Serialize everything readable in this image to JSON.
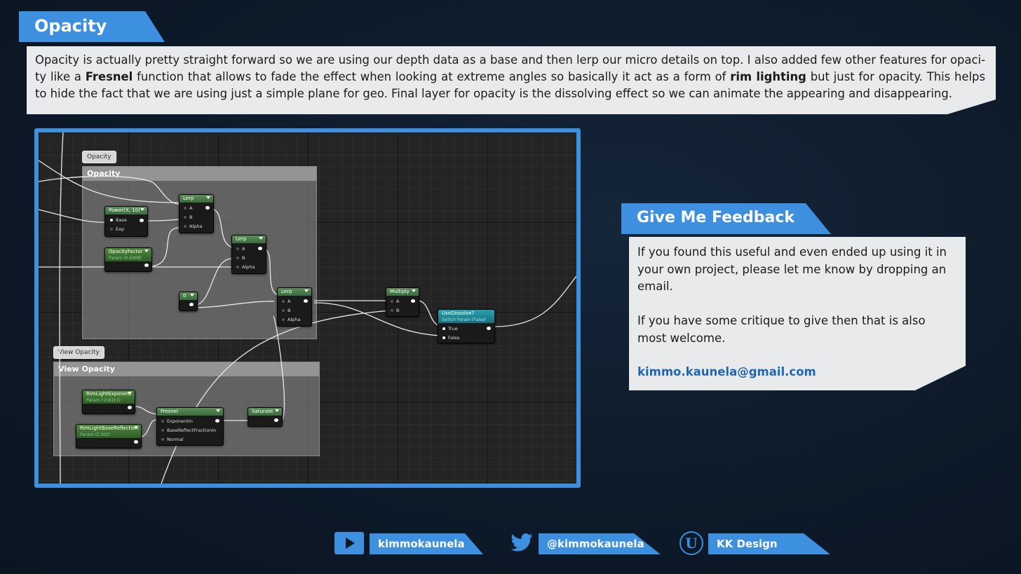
{
  "section_title": "Opacity",
  "intro": {
    "part1": "Opacity is actually pretty straight forward so we are using our depth data as a base and then lerp our micro details on top. I also added few other features for opaci-ty like a ",
    "bold1": "Fresnel",
    "part2": " function that allows to fade the effect when looking at extreme angles so basically it act as a form of ",
    "bold2": "rim lighting",
    "part3": " but just for opacity. This helps to hide the fact that we are using just a simple plane for geo. Final layer for opacity is the dissolving effect so we can animate the appearing and disappearing."
  },
  "graph": {
    "comment_opacity": {
      "bubble": "Opacity",
      "header": "Opacity"
    },
    "comment_view": {
      "bubble": "View Opacity",
      "header": "View Opacity"
    },
    "nodes": {
      "power": {
        "title": "Power(X, 10)",
        "pins": [
          "Base",
          "Exp"
        ]
      },
      "opacity_factor": {
        "title": "OpacityFactor",
        "sub": "Param (0.6309)"
      },
      "lerp1": {
        "title": "Lerp",
        "pins": [
          "A",
          "B",
          "Alpha"
        ]
      },
      "lerp2": {
        "title": "Lerp",
        "pins": [
          "A",
          "B",
          "Alpha"
        ]
      },
      "lerp3": {
        "title": "Lerp",
        "pins": [
          "A",
          "B",
          "Alpha"
        ]
      },
      "zero": {
        "title": "0"
      },
      "multiply": {
        "title": "Multiply",
        "pins": [
          "A",
          "B"
        ]
      },
      "use_dissolve": {
        "title": "UseDissolve?",
        "sub": "Switch Param (False)",
        "pins": [
          "True",
          "False"
        ]
      },
      "rim_exp": {
        "title": "RimLightExponent",
        "sub": "Param (-0.6317)"
      },
      "rim_base": {
        "title": "RimLightBaseReflection",
        "sub": "Param (2.302)"
      },
      "fresnel": {
        "title": "Fresnel",
        "pins": [
          "ExponentIn",
          "BaseReflectFractionIn",
          "Normal"
        ]
      },
      "saturate": {
        "title": "Saturate"
      }
    }
  },
  "feedback": {
    "title": "Give Me Feedback",
    "para1": "If you found this useful and even ended up using it in your own project, please let me know by dropping an email.",
    "para2": "If you have some critique to give then that is also most welcome.",
    "email": "kimmo.kaunela@gmail.com"
  },
  "social": [
    {
      "icon": "youtube-icon",
      "label": "kimmokaunela"
    },
    {
      "icon": "twitter-icon",
      "label": "@kimmokaunela"
    },
    {
      "icon": "unreal-icon",
      "label": "KK Design"
    }
  ],
  "colors": {
    "accent": "#3d8fe0",
    "panel": "#e9eaeb",
    "background": "#0d1a29"
  }
}
